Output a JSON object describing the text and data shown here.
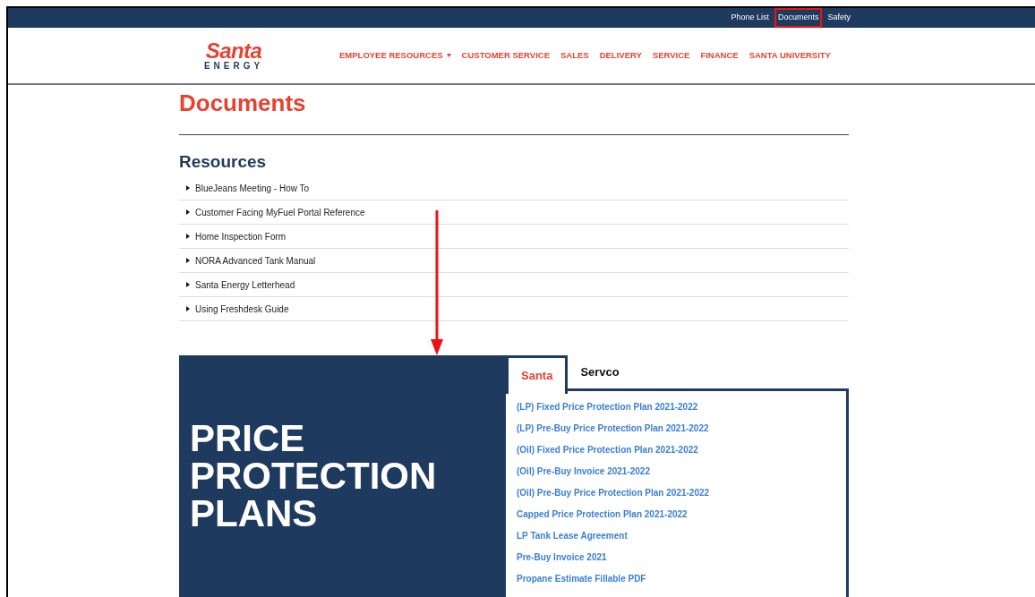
{
  "top_links": [
    {
      "label": "Phone List",
      "highlighted": false
    },
    {
      "label": "Documents",
      "highlighted": true
    },
    {
      "label": "Safety",
      "highlighted": false
    }
  ],
  "logo": {
    "script": "Santa",
    "word": "ENERGY"
  },
  "nav": [
    {
      "label": "EMPLOYEE RESOURCES",
      "dropdown": true
    },
    {
      "label": "CUSTOMER SERVICE",
      "dropdown": false
    },
    {
      "label": "SALES",
      "dropdown": false
    },
    {
      "label": "DELIVERY",
      "dropdown": false
    },
    {
      "label": "SERVICE",
      "dropdown": false
    },
    {
      "label": "FINANCE",
      "dropdown": false
    },
    {
      "label": "SANTA UNIVERSITY",
      "dropdown": false
    }
  ],
  "page_title": "Documents",
  "resources": {
    "heading": "Resources",
    "items": [
      "BlueJeans Meeting - How To",
      "Customer Facing MyFuel Portal Reference",
      "Home Inspection Form",
      "NORA Advanced Tank Manual",
      "Santa Energy Letterhead",
      "Using Freshdesk Guide"
    ]
  },
  "annotations": [
    {
      "kind": "arrow"
    }
  ],
  "price_protection": {
    "banner": [
      "PRICE",
      "PROTECTION",
      "PLANS"
    ],
    "tabs": [
      {
        "label": "Santa",
        "selected": true
      },
      {
        "label": "Servco",
        "selected": false
      }
    ],
    "links": [
      "(LP) Fixed Price Protection Plan 2021-2022",
      "(LP) Pre-Buy Price Protection Plan 2021-2022",
      "(Oil) Fixed Price Protection Plan 2021-2022",
      "(Oil) Pre-Buy Invoice 2021-2022",
      "(Oil) Pre-Buy Price Protection Plan 2021-2022",
      "Capped Price Protection Plan 2021-2022",
      "LP Tank Lease Agreement",
      "Pre-Buy Invoice 2021",
      "Propane Estimate Fillable PDF"
    ]
  }
}
